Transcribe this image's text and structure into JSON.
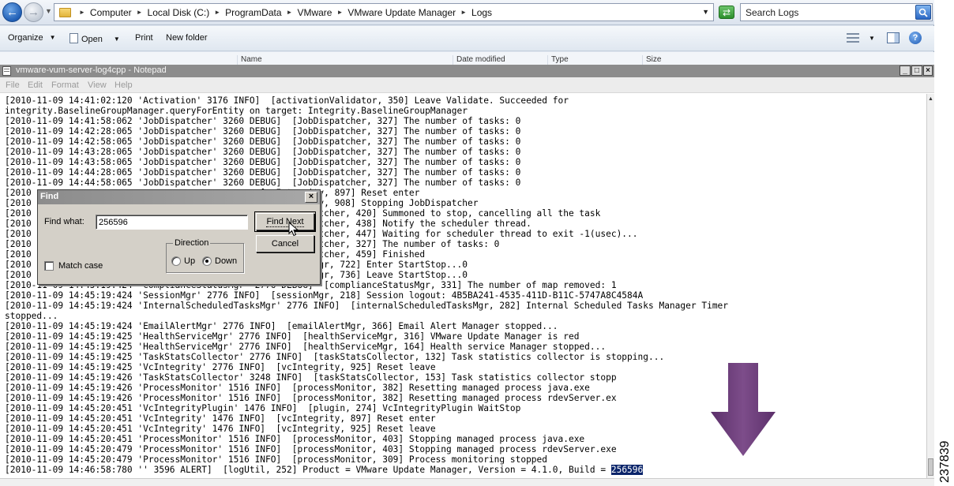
{
  "explorer": {
    "breadcrumb": [
      "Computer",
      "Local Disk (C:)",
      "ProgramData",
      "VMware",
      "VMware Update Manager",
      "Logs"
    ],
    "search_placeholder": "Search Logs",
    "toolbar": {
      "organize": "Organize",
      "open": "Open",
      "print": "Print",
      "new_folder": "New folder"
    },
    "columns": [
      "Name",
      "Date modified",
      "Type",
      "Size"
    ]
  },
  "notepad": {
    "title": "vmware-vum-server-log4cpp - Notepad",
    "menu": [
      "File",
      "Edit",
      "Format",
      "View",
      "Help"
    ],
    "lines": [
      "[2010-11-09 14:41:02:120 'Activation' 3176 INFO]  [activationValidator, 350] Leave Validate. Succeeded for",
      "integrity.BaselineGroupManager.queryForEntity on target: Integrity.BaselineGroupManager",
      "[2010-11-09 14:41:58:062 'JobDispatcher' 3260 DEBUG]  [JobDispatcher, 327] The number of tasks: 0",
      "[2010-11-09 14:42:28:065 'JobDispatcher' 3260 DEBUG]  [JobDispatcher, 327] The number of tasks: 0",
      "[2010-11-09 14:42:58:065 'JobDispatcher' 3260 DEBUG]  [JobDispatcher, 327] The number of tasks: 0",
      "[2010-11-09 14:43:28:065 'JobDispatcher' 3260 DEBUG]  [JobDispatcher, 327] The number of tasks: 0",
      "[2010-11-09 14:43:58:065 'JobDispatcher' 3260 DEBUG]  [JobDispatcher, 327] The number of tasks: 0",
      "[2010-11-09 14:44:28:065 'JobDispatcher' 3260 DEBUG]  [JobDispatcher, 327] The number of tasks: 0",
      "[2010-11-09 14:44:58:065 'JobDispatcher' 3260 DEBUG]  [JobDispatcher, 327] The number of tasks: 0",
      "[2010                                           [vcIntegrity, 897] Reset enter",
      "[2010                                           [vcIntegrity, 908] Stopping JobDispatcher",
      "[2010                                             [JobDispatcher, 420] Summoned to stop, cancelling all the task",
      "[2010                                             [JobDispatcher, 438] Notify the scheduler thread.",
      "[2010                                             [JobDispatcher, 447] Waiting for scheduler thread to exit -1(usec)...",
      "[2010                                             [JobDispatcher, 327] The number of tasks: 0",
      "[2010                                             [JobDispatcher, 459] Finished",
      "[2010                                            [baselineMgr, 722] Enter StartStop...0",
      "[2010                                            [baselineMgr, 736] Leave StartStop...0",
      "[2010-11-09 14:45:19:424 'complianceStatusMgr' 2776 DEBUG]  [complianceStatusMgr, 331] The number of map removed: 1",
      "[2010-11-09 14:45:19:424 'SessionMgr' 2776 INFO]  [sessionMgr, 218] Session logout: 4B5BA241-4535-411D-B11C-5747A8C4584A",
      "[2010-11-09 14:45:19:424 'InternalScheduledTasksMgr' 2776 INFO]  [internalScheduledTasksMgr, 282] Internal Scheduled Tasks Manager Timer",
      "stopped...",
      "[2010-11-09 14:45:19:424 'EmailAlertMgr' 2776 INFO]  [emailAlertMgr, 366] Email Alert Manager stopped...",
      "[2010-11-09 14:45:19:425 'HealthServiceMgr' 2776 INFO]  [healthServiceMgr, 316] VMware Update Manager is red",
      "[2010-11-09 14:45:19:425 'HealthServiceMgr' 2776 INFO]  [healthServiceMgr, 164] Health service Manager stopped...",
      "[2010-11-09 14:45:19:425 'TaskStatsCollector' 2776 INFO]  [taskStatsCollector, 132] Task statistics collector is stopping...",
      "[2010-11-09 14:45:19:425 'VcIntegrity' 2776 INFO]  [vcIntegrity, 925] Reset leave",
      "[2010-11-09 14:45:19:426 'TaskStatsCollector' 3248 INFO]  [taskStatsCollector, 153] Task statistics collector stopp",
      "[2010-11-09 14:45:19:426 'ProcessMonitor' 1516 INFO]  [processMonitor, 382] Resetting managed process java.exe",
      "[2010-11-09 14:45:19:426 'ProcessMonitor' 1516 INFO]  [processMonitor, 382] Resetting managed process rdevServer.ex",
      "[2010-11-09 14:45:20:451 'VcIntegrityPlugin' 1476 INFO]  [plugin, 274] VcIntegrityPlugin WaitStop",
      "[2010-11-09 14:45:20:451 'VcIntegrity' 1476 INFO]  [vcIntegrity, 897] Reset enter",
      "[2010-11-09 14:45:20:451 'VcIntegrity' 1476 INFO]  [vcIntegrity, 925] Reset leave",
      "[2010-11-09 14:45:20:451 'ProcessMonitor' 1516 INFO]  [processMonitor, 403] Stopping managed process java.exe",
      "[2010-11-09 14:45:20:479 'ProcessMonitor' 1516 INFO]  [processMonitor, 403] Stopping managed process rdevServer.exe",
      "[2010-11-09 14:45:20:479 'ProcessMonitor' 1516 INFO]  [processMonitor, 309] Process monitoring stopped"
    ],
    "last_line_prefix": "[2010-11-09 14:46:58:780 '' 3596 ALERT]  [logUtil, 252] Product = VMware Update Manager, Version = 4.1.0, Build = ",
    "last_line_highlight": "256596"
  },
  "find_dialog": {
    "title": "Find",
    "find_what_label": "Find what:",
    "find_what_value": "256596",
    "find_next_label": "Find Next",
    "cancel_label": "Cancel",
    "match_case_label": "Match case",
    "match_case_checked": false,
    "direction_label": "Direction",
    "up_label": "Up",
    "down_label": "Down",
    "direction_selected": "Down"
  },
  "annotation": {
    "figure_id": "237839",
    "arrow_color": "#7d4d8a"
  }
}
